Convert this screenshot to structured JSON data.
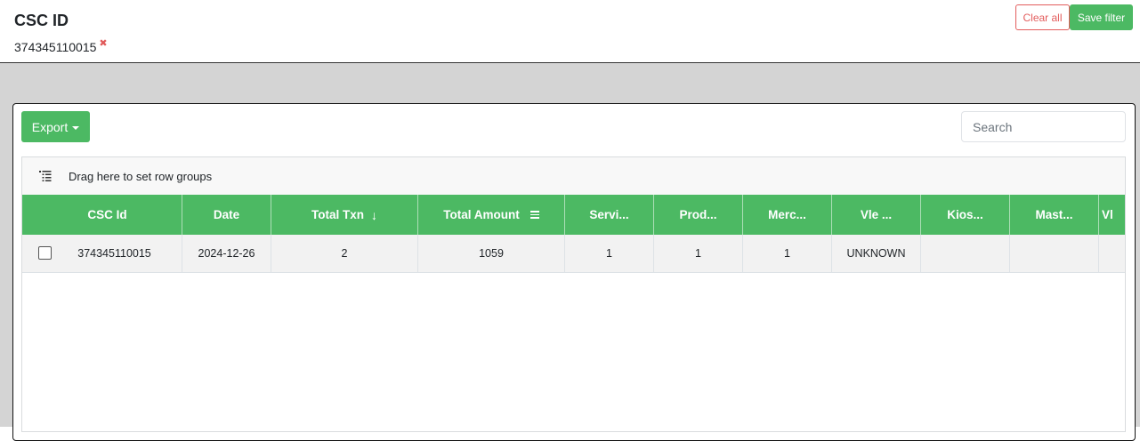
{
  "filter": {
    "title": "CSC ID",
    "chip_value": "374345110015",
    "chip_remove": "✖",
    "clear_label": "Clear all",
    "save_label": "Save filter"
  },
  "toolbar": {
    "export_label": "Export",
    "search_placeholder": "Search"
  },
  "grid": {
    "group_panel_text": "Drag here to set row groups",
    "columns": [
      {
        "label": "CSC Id"
      },
      {
        "label": "Date"
      },
      {
        "label": "Total Txn",
        "sort": "descending"
      },
      {
        "label": "Total Amount"
      },
      {
        "label": "Servi..."
      },
      {
        "label": "Prod..."
      },
      {
        "label": "Merc..."
      },
      {
        "label": "Vle ..."
      },
      {
        "label": "Kios..."
      },
      {
        "label": "Mast..."
      },
      {
        "label": "Vl"
      }
    ],
    "rows": [
      {
        "cells": [
          "374345110015",
          "2024-12-26",
          "2",
          "1059",
          "1",
          "1",
          "1",
          "UNKNOWN",
          "",
          "",
          ""
        ]
      }
    ]
  },
  "colors": {
    "accent": "#4cb963",
    "danger": "#e35d5d",
    "page_bg": "#d4d4d4"
  }
}
